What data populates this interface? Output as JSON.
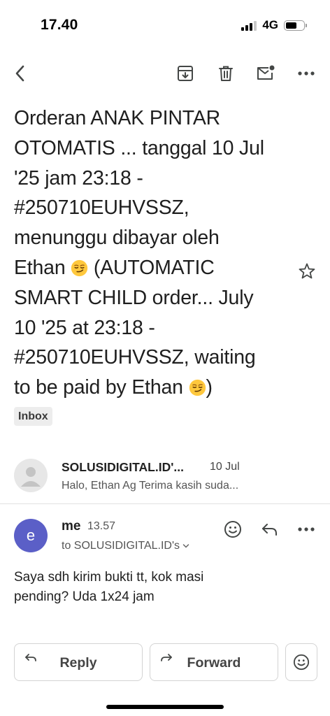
{
  "status_bar": {
    "time": "17.40",
    "network": "4G",
    "battery_level": 0.62
  },
  "toolbar": {
    "back_icon": "chevron-left-icon",
    "archive_icon": "archive-icon",
    "delete_icon": "trash-icon",
    "unread_icon": "mark-unread-icon",
    "more_icon": "more-horizontal-icon"
  },
  "email": {
    "subject_lines": [
      "Orderan ANAK PINTAR",
      "OTOMATIS ... tanggal 10 Jul",
      "'25 jam 23:18 -",
      "#250710EUHVSSZ,",
      "menunggu dibayar oleh",
      "Ethan",
      "(AUTOMATIC",
      "SMART CHILD order... July",
      "10 '25 at 23:18 -",
      "#250710EUHVSSZ, waiting",
      "to be paid by Ethan",
      ")"
    ],
    "subject_emoji": "smirking-face",
    "label": "Inbox",
    "star_icon": "star-outline-icon"
  },
  "thread": {
    "collapsed": {
      "sender": "SOLUSIDIGITAL.ID'...",
      "date": "10 Jul",
      "snippet": "Halo, Ethan Ag Terima kasih suda..."
    },
    "message": {
      "avatar_letter": "e",
      "from": "me",
      "time": "13.57",
      "to": "to SOLUSIDIGITAL.ID's",
      "body_lines": [
        "Saya sdh kirim bukti tt, kok masi",
        "pending? Uda 1x24 jam"
      ]
    }
  },
  "reply_bar": {
    "reply_label": "Reply",
    "forward_label": "Forward"
  },
  "colors": {
    "avatar_me": "#5b5fc7",
    "chip_bg": "#ededed",
    "text": "#1f1f1f",
    "icon": "#444746"
  }
}
